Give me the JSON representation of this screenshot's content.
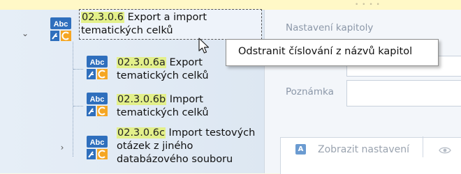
{
  "tree": {
    "nodes": [
      {
        "code": "02.3.0.6",
        "title_line1": " Export a import",
        "title_line2": "tematických celků",
        "expanded": true,
        "selected": true
      },
      {
        "code": "02.3.0.6a",
        "title_line1": " Export",
        "title_line2": "tematických celků"
      },
      {
        "code": "02.3.0.6b",
        "title_line1": " Import",
        "title_line2": "tematických celků"
      },
      {
        "code": "02.3.0.6c",
        "title_line1": " Import testových",
        "title_line2": "otázek z jiného",
        "title_line3": "databázového souboru",
        "expanded": false
      }
    ],
    "icon": {
      "name": "chapter-icon",
      "text": "Abc"
    }
  },
  "right_panel": {
    "chapter_settings_label": "Nastavení kapitoly",
    "note_label": "Poznámka",
    "show_settings_tab": "Zobrazit nastavení",
    "tab_icon_letter": "A"
  },
  "context_menu": {
    "items": [
      "Odstranit číslování z názvů kapitol"
    ]
  },
  "colors": {
    "code_highlight": "#e3f08a",
    "tree_background": "#e6eef7",
    "icon_blue": "#2f6fbd",
    "icon_orange": "#f5a623"
  }
}
